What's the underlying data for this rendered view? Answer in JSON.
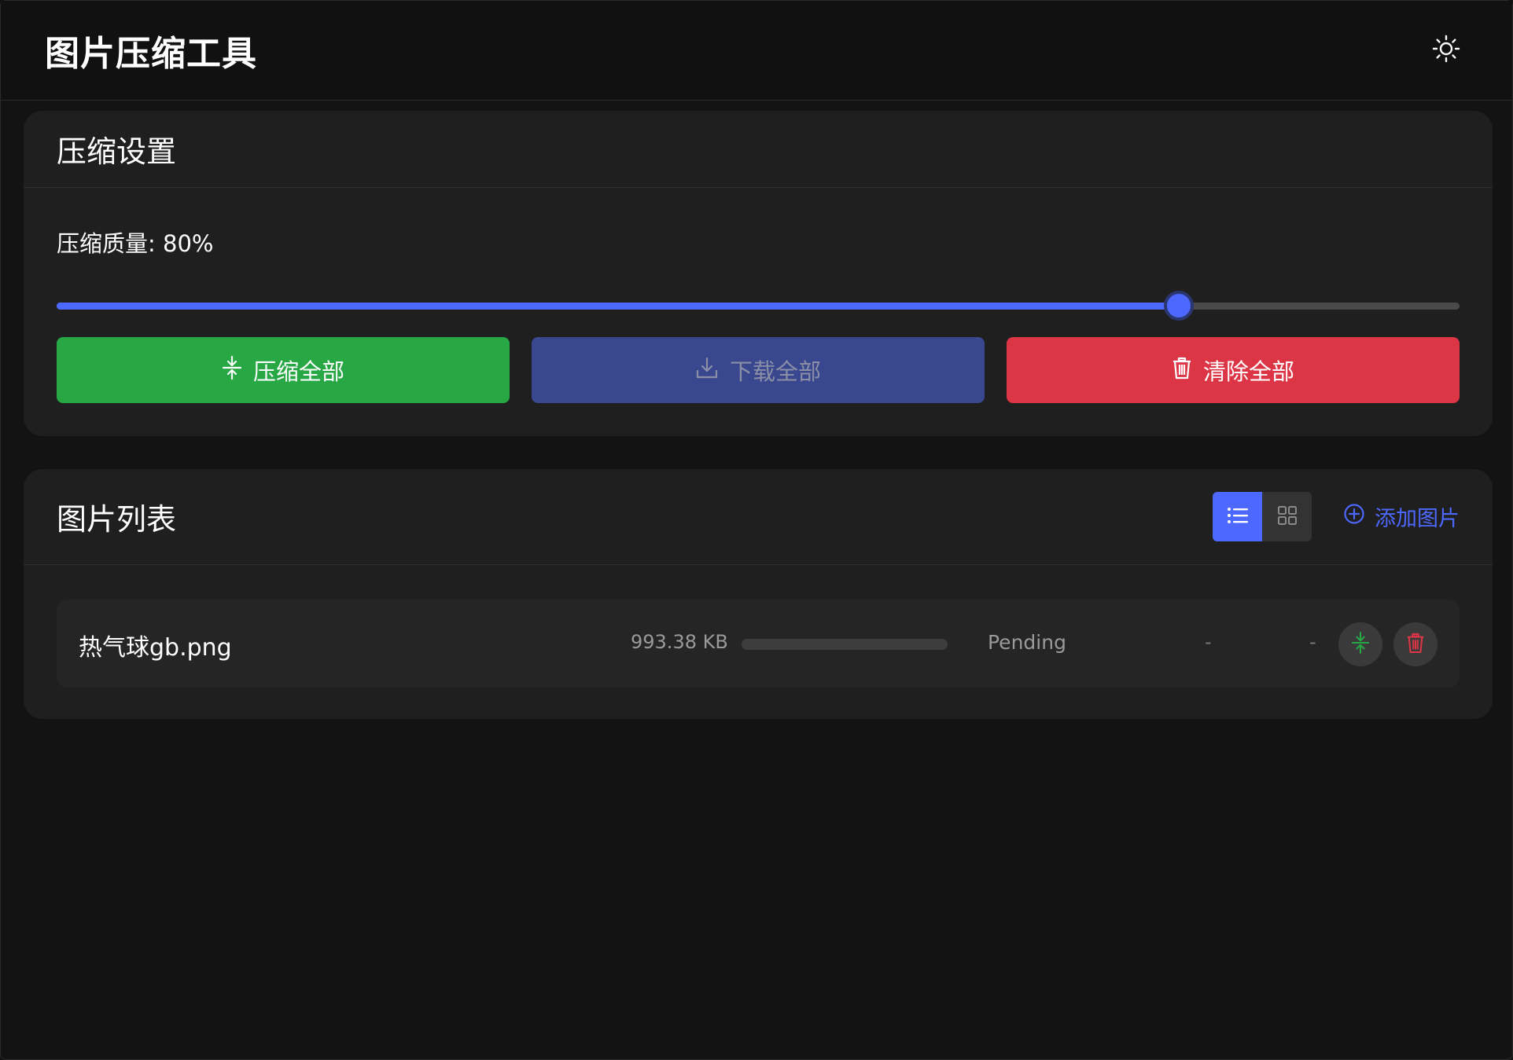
{
  "app": {
    "title": "图片压缩工具"
  },
  "settings": {
    "title": "压缩设置",
    "quality_label": "压缩质量: 80%",
    "quality_value": 80,
    "compress_all": "压缩全部",
    "download_all": "下载全部",
    "clear_all": "清除全部"
  },
  "list": {
    "title": "图片列表",
    "add_label": "添加图片",
    "view": "list",
    "files": [
      {
        "name": "热气球gb.png",
        "size": "993.38 KB",
        "progress": 0,
        "status": "Pending",
        "compressed_size": "-",
        "ratio": "-"
      }
    ]
  },
  "colors": {
    "accent": "#4d68ff",
    "success": "#28a745",
    "danger": "#dc3545",
    "download": "#39478f"
  },
  "icons": {
    "theme": "sun-icon",
    "compress": "compress-icon",
    "download": "download-icon",
    "trash": "trash-icon",
    "list_view": "list-view-icon",
    "grid_view": "grid-view-icon",
    "add": "plus-circle-icon"
  }
}
